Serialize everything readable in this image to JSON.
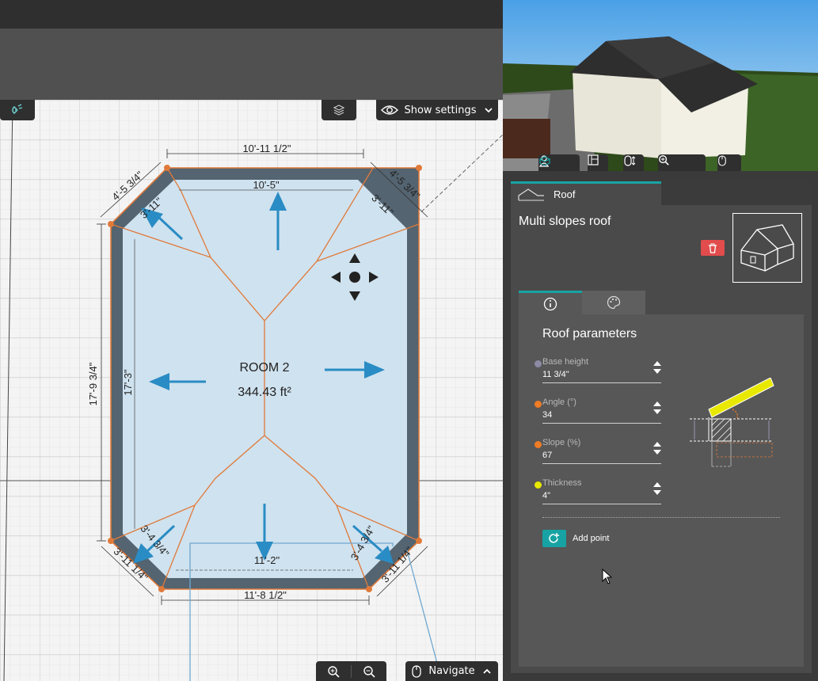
{
  "plan": {
    "show_settings_label": "Show settings",
    "navigate_label": "Navigate",
    "room_name": "ROOM 2",
    "room_area": "344.43 ft²",
    "dims": {
      "top_outer": "10'-11 1/2\"",
      "top_inner": "10'-5\"",
      "left_outer": "17'-9 3/4\"",
      "left_inner": "17'-3\"",
      "bottom_outer": "11'-8 1/2\"",
      "bottom_inner": "11'-2\"",
      "tl_outer": "4'-5 3/4\"",
      "tl_inner": "3'-11\"",
      "tr_outer": "4'-5 3/4\"",
      "tr_inner": "3'-11\"",
      "bl_outer": "3'-11 1/4\"",
      "bl_inner": "3'-4 3/4\"",
      "br_outer": "3'-11 1/4\"",
      "br_inner": "3'-4 3/4\""
    }
  },
  "panel": {
    "tab_label": "Roof",
    "title": "Multi slopes roof",
    "params_title": "Roof parameters",
    "fields": [
      {
        "label": "Base height",
        "value": "11 3/4\"",
        "color": "#8d8aa6"
      },
      {
        "label": "Angle (°)",
        "value": "34",
        "color": "#f07c26"
      },
      {
        "label": "Slope (%)",
        "value": "67",
        "color": "#f07c26"
      },
      {
        "label": "Thickness",
        "value": "4\"",
        "color": "#e8e800"
      }
    ],
    "add_point_label": "Add point"
  },
  "colors": {
    "accent": "#17a3a3",
    "roof_edge": "#e07a3a",
    "arrow": "#2a8cc4",
    "delete": "#e24c4c"
  }
}
